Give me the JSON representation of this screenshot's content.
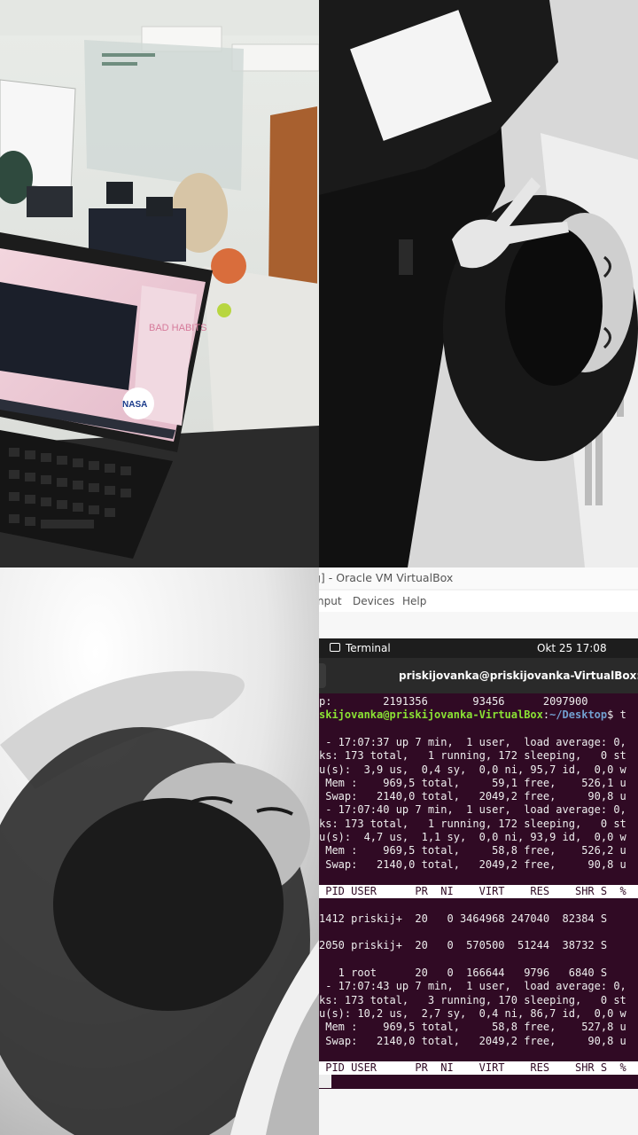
{
  "vbox": {
    "window_title": "g] - Oracle VM VirtualBox",
    "menu": [
      "nput",
      "Devices",
      "Help"
    ],
    "topbar": {
      "app": "Terminal",
      "datetime": "Okt 25  17:08"
    },
    "terminal_title": "priskijovanka@priskijovanka-VirtualBox: ~/De",
    "lines": [
      "p:        2191356       93456      2097900",
      "skijovanka@priskijovanka-VirtualBox:~/Desktop$ t",
      "",
      " - 17:07:37 up 7 min,  1 user,  load average: 0,",
      "ks: 173 total,   1 running, 172 sleeping,   0 st",
      "u(s):  3,9 us,  0,4 sy,  0,0 ni, 95,7 id,  0,0 w",
      " Mem :    969,5 total,     59,1 free,    526,1 u",
      " Swap:   2140,0 total,   2049,2 free,     90,8 u",
      " - 17:07:40 up 7 min,  1 user,  load average: 0,",
      "ks: 173 total,   1 running, 172 sleeping,   0 st",
      "u(s):  4,7 us,  1,1 sy,  0,0 ni, 93,9 id,  0,0 w",
      " Mem :    969,5 total,     58,8 free,    526,2 u",
      " Swap:   2140,0 total,   2049,2 free,     90,8 u",
      "",
      " PID USER      PR  NI    VIRT    RES    SHR S  %",
      "",
      "1412 priskij+  20   0 3464968 247040  82384 S",
      "",
      "2050 priskij+  20   0  570500  51244  38732 S",
      "",
      "   1 root      20   0  166644   9796   6840 S",
      " - 17:07:43 up 7 min,  1 user,  load average: 0,",
      "ks: 173 total,   3 running, 170 sleeping,   0 st",
      "u(s): 10,2 us,  2,7 sy,  0,4 ni, 86,7 id,  0,0 w",
      " Mem :    969,5 total,     58,8 free,    527,8 u",
      " Swap:   2140,0 total,   2049,2 free,     90,8 u",
      "",
      " PID USER      PR  NI    VIRT    RES    SHR S  %"
    ],
    "prompt_user": "skijovanka@priskijovanka-VirtualBox",
    "prompt_path": "~/Desktop",
    "prompt_tail": "$ t"
  },
  "photo_labels": {
    "laptop_sticker": "NASA",
    "screen_text": "BAD HABITS"
  }
}
